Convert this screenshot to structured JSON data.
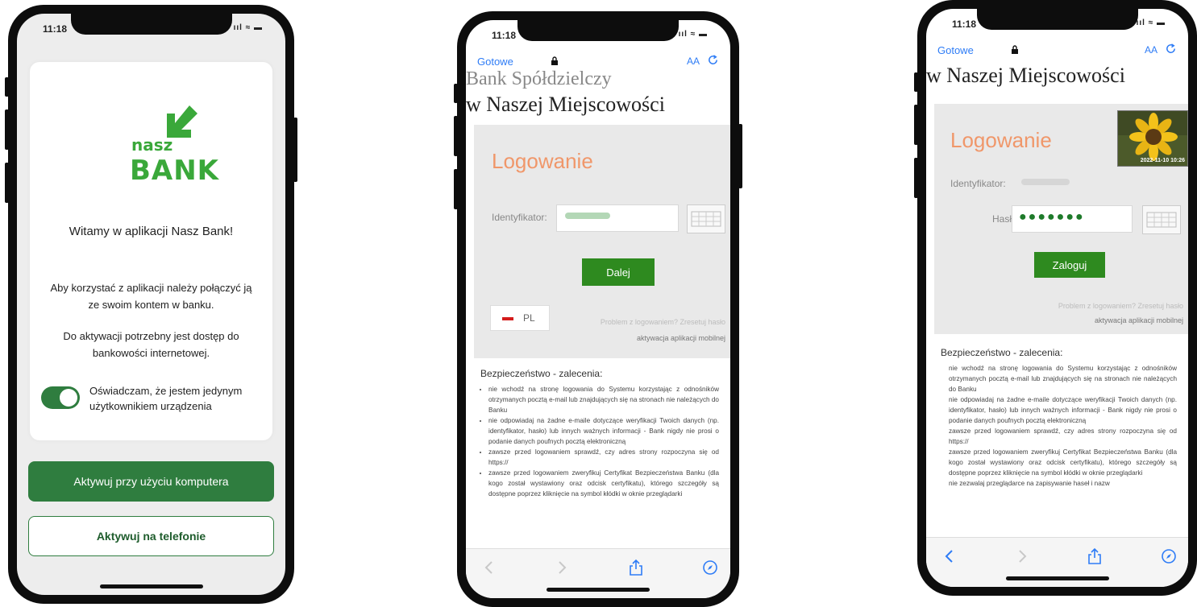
{
  "status": {
    "time": "11:18",
    "signal": "ııl ≈ ▬"
  },
  "phone1": {
    "logo_small": "nasz",
    "logo_big": "BANK",
    "welcome": "Witamy w aplikacji Nasz Bank!",
    "info1": "Aby korzystać z aplikacji należy połączyć ją ze swoim kontem w banku.",
    "info2": "Do aktywacji potrzebny jest dostęp do bankowości internetowej.",
    "toggle_label": "Oświadczam, że jestem jedynym użytkownikiem urządzenia",
    "toggle_on": true,
    "btn_computer": "Aktywuj przy użyciu komputera",
    "btn_phone": "Aktywuj na telefonie",
    "colors": {
      "brand": "#2f7d3f",
      "logo_green": "#3aa83a"
    }
  },
  "browser": {
    "done": "Gotowe",
    "aa": "AA",
    "bank_name_cut": "Bank Spółdzielczy",
    "bank_name": "w Naszej Miejscowości",
    "login_title": "Logowanie",
    "id_label": "Identyfikator:",
    "password_label": "Hasło",
    "password_dots": "●●●●●●●",
    "next_btn": "Dalej",
    "login_btn": "Zaloguj",
    "lang": "PL",
    "problem_link": "Problem z logowaniem? Zresetuj hasło",
    "activation_link": "aktywacja aplikacji mobilnej",
    "photo_date": "2022-11-10 10:26",
    "sec_title": "Bezpieczeństwo - zalecenia:",
    "sec_items": [
      "nie wchodź na stronę logowania do Systemu korzystając z odnośników otrzymanych pocztą e-mail lub znajdujących się na stronach nie należących do Banku",
      "nie odpowiadaj na żadne e-maile dotyczące weryfikacji Twoich danych (np. identyfikator, hasło) lub innych ważnych informacji - Bank nigdy nie prosi o podanie danych poufnych pocztą elektroniczną",
      "zawsze przed logowaniem sprawdź, czy adres strony rozpoczyna się od https://",
      "zawsze przed logowaniem zweryfikuj Certyfikat Bezpieczeństwa Banku (dla kogo został wystawiony oraz odcisk certyfikatu), którego szczegóły są dostępne poprzez kliknięcie na symbol kłódki w oknie przeglądarki",
      "nie zezwalaj przeglądarce na zapisywanie haseł i nazw"
    ],
    "colors": {
      "link": "#2e7cf6",
      "accent": "#f0976a",
      "button": "#2e8a1f"
    }
  }
}
